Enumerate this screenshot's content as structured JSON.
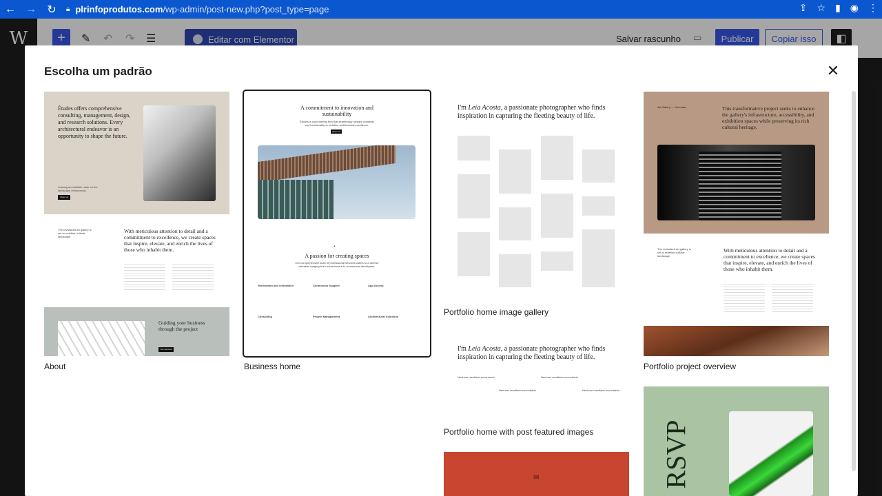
{
  "browser": {
    "url_host": "plrinfoprodutos.com",
    "url_path": "/wp-admin/post-new.php?post_type=page"
  },
  "toolbar": {
    "elementor_label": "Editar com Elementor",
    "save_draft_label": "Salvar rascunho",
    "publish_label": "Publicar",
    "copy_label": "Copiar isso"
  },
  "modal": {
    "title": "Escolha um padrão"
  },
  "patterns": [
    {
      "label": "About"
    },
    {
      "label": "Business home"
    },
    {
      "label": "Portfolio home image gallery"
    },
    {
      "label": "Portfolio project overview"
    },
    {
      "label": "Portfolio home with post featured images"
    }
  ],
  "previews": {
    "about": {
      "intro": "Études offers comprehensive consulting, management, design, and research solutions. Every architectural endeavor is an opportunity to shape the future.",
      "tagline": "Leaving an indelible mark on the landscape of tomorrow.",
      "btn": "About us",
      "side": "The revitalized art gallery is set to redefine cultural landscape.",
      "heading": "With meticulous attention to detail and a commitment to excellence, we create spaces that inspire, elevate, and enrich the lives of those who inhabit them.",
      "guide": "Guiding your business through the project",
      "guide_btn": "Our services"
    },
    "business": {
      "heading": "A commitment to innovation and sustainability",
      "sub": "Études is a pioneering firm that seamlessly merges creativity and functionality to redefine architectural excellence.",
      "btn": "About us",
      "passion": "A passion for creating spaces",
      "passion_sub": "Our comprehensive suite of professional services caters to a diverse clientele, ranging from homeowners to commercial developers.",
      "services": [
        "Renovation and restoration",
        "Continuous Support",
        "App Access",
        "Consulting",
        "Project Management",
        "Architectural Solutions"
      ]
    },
    "gallery": {
      "text_prefix": "I'm ",
      "name": "Leia Acosta",
      "text_suffix": ", a passionate photographer who finds inspiration in capturing the fleeting beauty of life."
    },
    "overview": {
      "small": "Art Gallery — Overview",
      "heading": "This transformative project seeks to enhance the gallery's infrastructure, accessibility, and exhibition spaces while preserving its rich cultural heritage.",
      "body_heading": "With meticulous attention to detail and a commitment to excellence, we create spaces that inspire, elevate, and enrich the lives of those who inhabit them."
    },
    "featured": {
      "no_results": "Nenhum resultado encontrado."
    },
    "rsvp": {
      "word": "RSVP"
    }
  }
}
